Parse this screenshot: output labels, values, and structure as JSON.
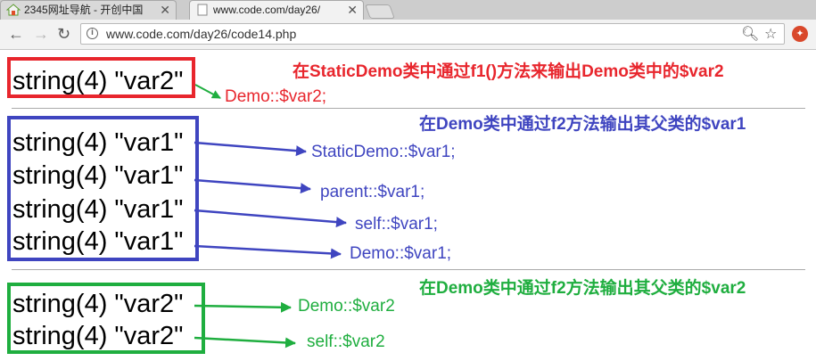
{
  "browser": {
    "tabs": [
      {
        "title": "2345网址导航 - 开创中国"
      },
      {
        "title": "www.code.com/day26/"
      }
    ],
    "url": "www.code.com/day26/code14.php",
    "icons": [
      "back-icon",
      "forward-icon",
      "reload-icon",
      "info-icon",
      "zoom-icon",
      "star-icon",
      "extension-icon"
    ]
  },
  "colors": {
    "red": "#e8262d",
    "blue": "#3f45c0",
    "green": "#1fae3f"
  },
  "section_red": {
    "outputs": [
      "string(4) \"var2\""
    ],
    "note": "Demo::$var2;",
    "title": "在StaticDemo类中通过f1()方法来输出Demo类中的$var2"
  },
  "section_blue": {
    "title": "在Demo类中通过f2方法输出其父类的$var1",
    "outputs": [
      "string(4) \"var1\"",
      "string(4) \"var1\"",
      "string(4) \"var1\"",
      "string(4) \"var1\""
    ],
    "notes": [
      "StaticDemo::$var1;",
      "parent::$var1;",
      "self::$var1;",
      "Demo::$var1;"
    ]
  },
  "section_green": {
    "title": "在Demo类中通过f2方法输出其父类的$var2",
    "outputs": [
      "string(4) \"var2\"",
      "string(4) \"var2\""
    ],
    "notes": [
      "Demo::$var2",
      "self::$var2"
    ]
  }
}
